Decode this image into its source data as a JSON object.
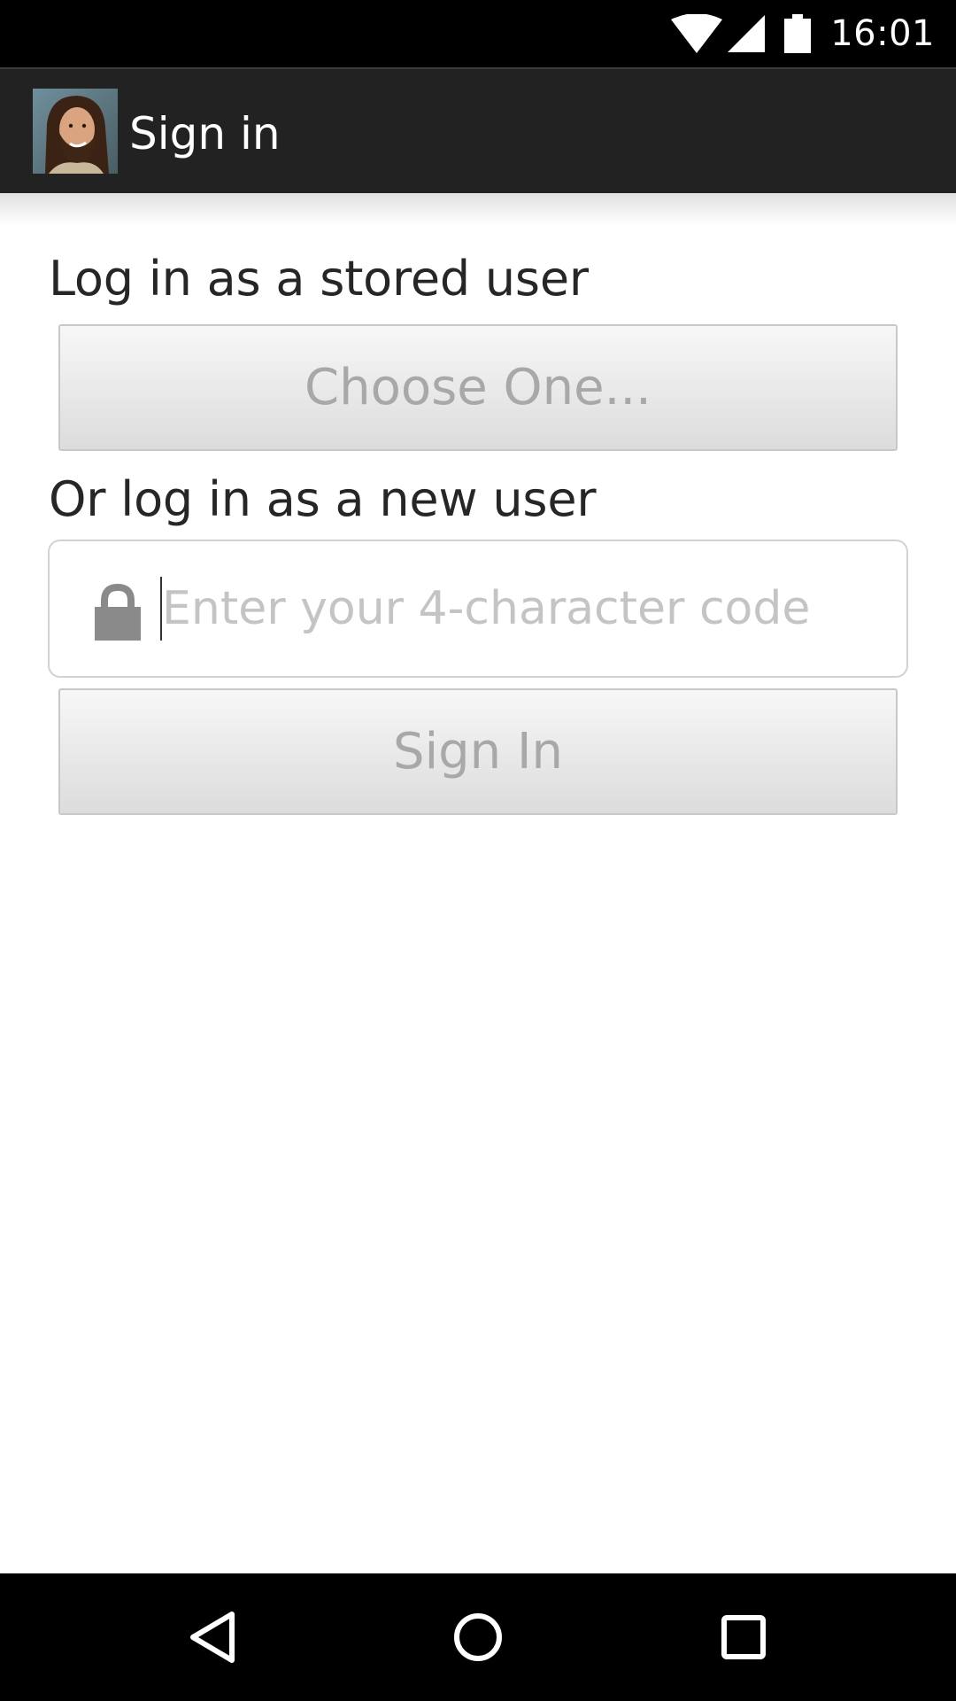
{
  "status_bar": {
    "time": "16:01",
    "icons": [
      "wifi-icon",
      "cell-signal-icon",
      "battery-icon"
    ]
  },
  "action_bar": {
    "title": "Sign in",
    "avatar": "app-avatar-portrait"
  },
  "stored_user": {
    "label": "Log in as a stored user",
    "chooser_label": "Choose One..."
  },
  "new_user": {
    "label": "Or log in as a new user",
    "code_field": {
      "value": "",
      "placeholder": "Enter your 4-character code",
      "icon": "lock-icon"
    },
    "sign_in_label": "Sign In"
  },
  "navigation_bar": {
    "icons": [
      "back-icon",
      "home-icon",
      "recents-icon"
    ]
  },
  "colors": {
    "status_bar": "#000000",
    "action_bar": "#222222",
    "button_text": "#a8a8a8",
    "label_text": "#262626",
    "placeholder": "#c4c4c4"
  }
}
